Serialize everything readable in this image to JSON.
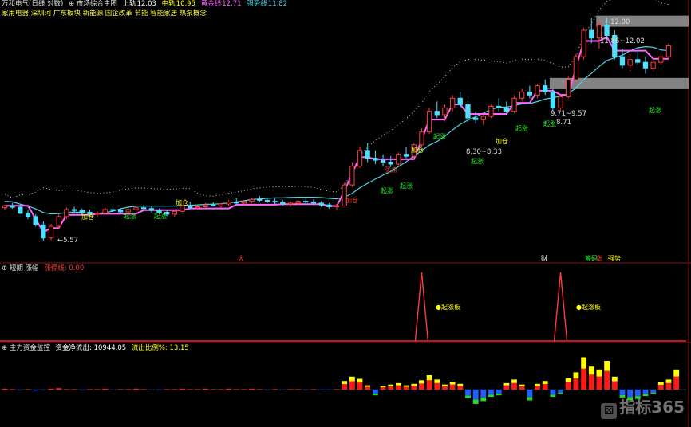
{
  "header": {
    "stock": "万和电气(日线 对数)",
    "indicator": "⊕ 市场综合主图",
    "upper_label": "上轨",
    "upper_value": "12.03",
    "mid_label": "中轨",
    "mid_value": "10.95",
    "lower_label": "黄金线",
    "lower_value": "12.71",
    "ma_label": "强势线",
    "ma_value": "11.82",
    "concepts": "家用电器 深圳河 广东板块 新能源 国企改革 节能 智能家居 热泵概念"
  },
  "panel2": {
    "title": "⊕ 短期 涨幅",
    "value_label": "涨停线: 0.00",
    "peak_label": "起涨板"
  },
  "panel3": {
    "title": "⊕ 主力资金监控",
    "flow_label": "资金净流出: 10944.05",
    "ratio_label": "流出比例%: 13.15"
  },
  "price_labels": {
    "low": "5.57",
    "high": "12.00",
    "high_range": "11.86~12.02",
    "range1": "9.71~9.57",
    "price2": "8.71",
    "range3": "8.30~8.33"
  },
  "signals": {
    "add": "加仓",
    "rise": "起涨",
    "buy": "买点",
    "chip": "筹码",
    "up": "涨",
    "strong": "强势",
    "big": "大",
    "fortune": "财"
  },
  "colors": {
    "up": "#ff3b3b",
    "down": "#4fdfff",
    "band": "#54d4e6",
    "strong_line": "#ff66ff",
    "dots": "#c8c8c8",
    "panel_border": "#8b1010",
    "flow_up": "#ff1a1a",
    "flow_yellow": "#ffff00",
    "flow_down": "#1f5fff",
    "flow_green": "#22dd22"
  },
  "chart_data": {
    "type": "candlestick",
    "title": "万和电气(日线 对数)",
    "candles": [
      [
        6.24,
        6.3,
        6.2,
        6.28
      ],
      [
        6.28,
        6.34,
        6.22,
        6.25
      ],
      [
        6.25,
        6.3,
        6.1,
        6.12
      ],
      [
        6.12,
        6.18,
        6.0,
        6.05
      ],
      [
        6.05,
        6.1,
        5.85,
        5.88
      ],
      [
        5.88,
        5.95,
        5.57,
        5.62
      ],
      [
        5.62,
        5.9,
        5.58,
        5.85
      ],
      [
        5.85,
        6.1,
        5.8,
        6.05
      ],
      [
        6.05,
        6.25,
        6.0,
        6.2
      ],
      [
        6.2,
        6.26,
        6.12,
        6.18
      ],
      [
        6.18,
        6.22,
        6.08,
        6.14
      ],
      [
        6.14,
        6.2,
        6.06,
        6.1
      ],
      [
        6.1,
        6.16,
        6.04,
        6.12
      ],
      [
        6.12,
        6.24,
        6.1,
        6.2
      ],
      [
        6.2,
        6.26,
        6.15,
        6.18
      ],
      [
        6.18,
        6.22,
        6.1,
        6.15
      ],
      [
        6.15,
        6.22,
        6.12,
        6.2
      ],
      [
        6.2,
        6.28,
        6.16,
        6.24
      ],
      [
        6.24,
        6.3,
        6.18,
        6.22
      ],
      [
        6.22,
        6.26,
        6.14,
        6.18
      ],
      [
        6.18,
        6.22,
        6.1,
        6.14
      ],
      [
        6.14,
        6.2,
        6.06,
        6.1
      ],
      [
        6.1,
        6.18,
        6.05,
        6.16
      ],
      [
        6.16,
        6.3,
        6.14,
        6.28
      ],
      [
        6.28,
        6.36,
        6.22,
        6.24
      ],
      [
        6.24,
        6.3,
        6.18,
        6.26
      ],
      [
        6.26,
        6.34,
        6.22,
        6.3
      ],
      [
        6.3,
        6.36,
        6.26,
        6.28
      ],
      [
        6.28,
        6.34,
        6.24,
        6.32
      ],
      [
        6.32,
        6.4,
        6.28,
        6.36
      ],
      [
        6.36,
        6.44,
        6.3,
        6.34
      ],
      [
        6.34,
        6.4,
        6.3,
        6.38
      ],
      [
        6.38,
        6.46,
        6.34,
        6.42
      ],
      [
        6.42,
        6.5,
        6.36,
        6.4
      ],
      [
        6.4,
        6.46,
        6.34,
        6.38
      ],
      [
        6.38,
        6.44,
        6.32,
        6.36
      ],
      [
        6.36,
        6.4,
        6.28,
        6.32
      ],
      [
        6.32,
        6.38,
        6.26,
        6.34
      ],
      [
        6.34,
        6.4,
        6.3,
        6.38
      ],
      [
        6.38,
        6.44,
        6.32,
        6.36
      ],
      [
        6.36,
        6.42,
        6.3,
        6.34
      ],
      [
        6.34,
        6.38,
        6.26,
        6.3
      ],
      [
        6.3,
        6.34,
        6.22,
        6.26
      ],
      [
        6.26,
        6.32,
        6.2,
        6.28
      ],
      [
        6.28,
        6.8,
        6.26,
        6.75
      ],
      [
        6.75,
        7.3,
        6.7,
        7.2
      ],
      [
        7.2,
        7.7,
        7.15,
        7.6
      ],
      [
        7.6,
        7.8,
        7.3,
        7.4
      ],
      [
        7.4,
        7.6,
        7.25,
        7.35
      ],
      [
        7.35,
        7.5,
        7.2,
        7.3
      ],
      [
        7.3,
        7.45,
        7.18,
        7.25
      ],
      [
        7.25,
        7.55,
        7.22,
        7.5
      ],
      [
        7.5,
        7.7,
        7.4,
        7.45
      ],
      [
        7.45,
        7.8,
        7.42,
        7.75
      ],
      [
        7.75,
        8.2,
        7.7,
        8.1
      ],
      [
        8.1,
        8.8,
        8.05,
        8.7
      ],
      [
        8.7,
        9.0,
        8.5,
        8.6
      ],
      [
        8.6,
        8.9,
        8.4,
        8.8
      ],
      [
        8.8,
        9.2,
        8.7,
        9.1
      ],
      [
        9.1,
        9.3,
        8.8,
        8.9
      ],
      [
        8.9,
        9.0,
        8.4,
        8.5
      ],
      [
        8.5,
        8.7,
        8.33,
        8.45
      ],
      [
        8.45,
        8.6,
        8.3,
        8.55
      ],
      [
        8.55,
        8.9,
        8.5,
        8.85
      ],
      [
        8.85,
        9.1,
        8.7,
        8.8
      ],
      [
        8.8,
        9.0,
        8.6,
        8.7
      ],
      [
        8.7,
        9.2,
        8.65,
        9.1
      ],
      [
        9.1,
        9.4,
        9.0,
        9.3
      ],
      [
        9.3,
        9.5,
        9.1,
        9.2
      ],
      [
        9.2,
        9.57,
        9.1,
        9.5
      ],
      [
        9.5,
        9.71,
        9.2,
        9.3
      ],
      [
        9.3,
        9.4,
        8.71,
        8.8
      ],
      [
        8.8,
        9.2,
        8.75,
        9.15
      ],
      [
        9.15,
        9.8,
        9.1,
        9.7
      ],
      [
        9.7,
        10.6,
        9.65,
        10.5
      ],
      [
        10.5,
        11.6,
        10.4,
        11.5
      ],
      [
        11.5,
        12.0,
        11.0,
        11.2
      ],
      [
        11.2,
        11.86,
        10.8,
        11.7
      ],
      [
        11.7,
        12.02,
        11.2,
        11.3
      ],
      [
        11.3,
        11.5,
        10.4,
        10.5
      ],
      [
        10.5,
        10.8,
        10.1,
        10.2
      ],
      [
        10.2,
        10.6,
        10.0,
        10.4
      ],
      [
        10.4,
        10.7,
        10.2,
        10.3
      ],
      [
        10.3,
        10.5,
        9.9,
        10.1
      ],
      [
        10.1,
        10.4,
        9.95,
        10.3
      ],
      [
        10.3,
        10.6,
        10.2,
        10.5
      ],
      [
        10.5,
        11.0,
        10.4,
        10.9
      ]
    ],
    "ylim": [
      5.57,
      12.02
    ],
    "panel2_peaks": [
      54,
      72
    ],
    "flow_values": [
      0.2,
      0.1,
      -0.1,
      0.1,
      -0.2,
      -0.1,
      0.2,
      0.3,
      0.1,
      0.1,
      -0.1,
      0.1,
      0.1,
      0.2,
      -0.1,
      0.1,
      0.1,
      0.2,
      0.1,
      -0.1,
      -0.1,
      0.1,
      0.1,
      0.2,
      0.1,
      0.1,
      0.2,
      0.1,
      0.1,
      0.2,
      0.1,
      0.1,
      0.2,
      0.1,
      -0.1,
      0.1,
      -0.1,
      0.1,
      0.1,
      -0.1,
      0.1,
      -0.1,
      -0.1,
      0.1,
      1.2,
      1.8,
      1.5,
      0.6,
      -0.8,
      0.5,
      0.7,
      0.9,
      0.6,
      0.8,
      1.3,
      2.0,
      1.4,
      0.7,
      1.1,
      0.8,
      -1.2,
      -2.0,
      -1.6,
      -1.0,
      -0.8,
      0.9,
      1.4,
      0.7,
      -1.5,
      0.8,
      1.2,
      -1.0,
      -0.6,
      1.6,
      2.4,
      4.5,
      3.2,
      2.8,
      4.0,
      1.8,
      -1.1,
      -1.5,
      -1.3,
      -0.9,
      -0.6,
      1.0,
      1.4,
      2.8
    ]
  }
}
